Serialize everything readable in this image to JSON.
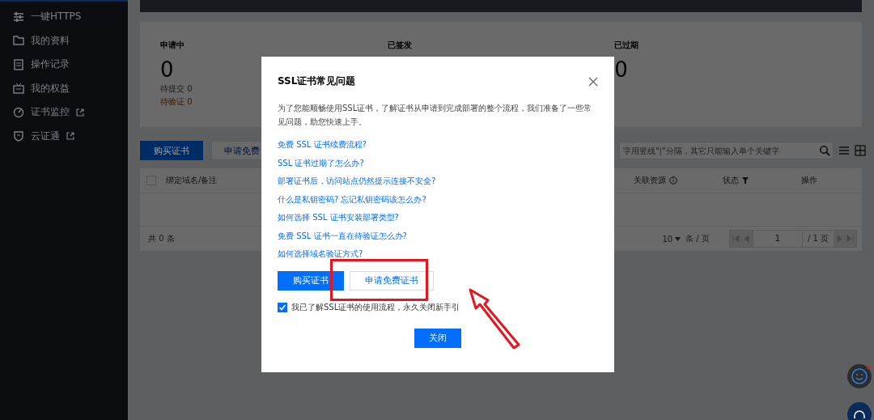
{
  "sidebar": {
    "items": [
      {
        "label": "一键HTTPS",
        "external": false
      },
      {
        "label": "我的资料",
        "external": false
      },
      {
        "label": "操作记录",
        "external": false
      },
      {
        "label": "我的权益",
        "external": false
      },
      {
        "label": "证书监控",
        "external": true
      },
      {
        "label": "云证通",
        "external": true
      }
    ]
  },
  "stats": [
    {
      "label": "申请中",
      "value": "0",
      "details": [
        {
          "text": "待提交 0",
          "kind": "muted"
        },
        {
          "text": "待验证 0",
          "kind": "warning"
        }
      ]
    },
    {
      "label": "已签发"
    },
    {
      "label": "已过期",
      "value": "0"
    }
  ],
  "toolbar": {
    "buttons": [
      {
        "label": "购买证书",
        "kind": "primary"
      },
      {
        "label": "申请免费",
        "kind": "default"
      }
    ],
    "search": {
      "placeholder": "字用竖线\"|\"分隔，其它只能输入单个关键字"
    }
  },
  "table": {
    "select_all": {
      "checked": false
    },
    "columns": [
      {
        "label": "绑定域名/备注",
        "kind": "plain"
      },
      {
        "label": "关联资源",
        "kind": "info"
      },
      {
        "label": "状态",
        "kind": "filter"
      },
      {
        "label": "操作",
        "kind": "plain"
      }
    ]
  },
  "pagination": {
    "total": "共 0 条",
    "page_size": "10",
    "per_page": "条 / 页",
    "page": "1",
    "pages": "/ 1 页"
  },
  "dialog": {
    "title": "SSL证书常见问题",
    "intro": "为了您能顺畅使用SSL证书，了解证书从申请到完成部署的整个流程，我们准备了一些常见问题，助您快速上手。",
    "links": [
      "免费 SSL 证书续费流程?",
      "SSL 证书过期了怎么办?",
      "部署证书后，访问站点仍然提示连接不安全?",
      "什么是私钥密码? 忘记私钥密码该怎么办?",
      "如何选择 SSL 证书安装部署类型?",
      "免费 SSL 证书一直在待验证怎么办?",
      "如何选择域名验证方式?"
    ],
    "actions": [
      {
        "label": "购买证书",
        "kind": "primary"
      },
      {
        "label": "申请免费证书",
        "kind": "default"
      }
    ],
    "dont_show_again": {
      "label": "我已了解SSL证书的使用流程，永久关闭新手引",
      "checked": true
    },
    "close_label": "关闭"
  }
}
